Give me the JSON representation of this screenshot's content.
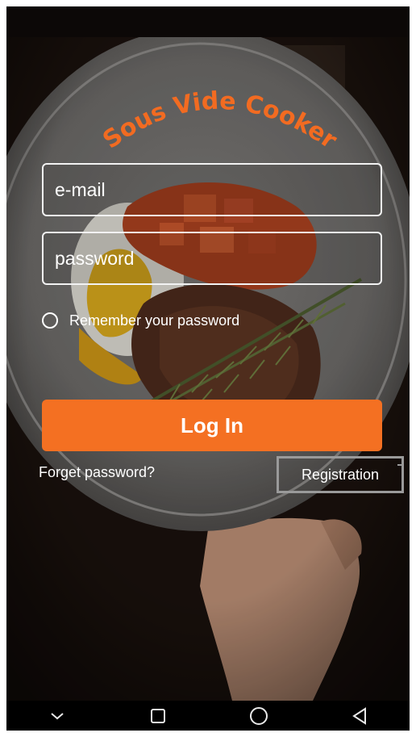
{
  "status_bar": {
    "left_text": "",
    "right_text": ""
  },
  "app": {
    "title": "Sous Vide Cooker"
  },
  "login_form": {
    "email_placeholder": "e-mail",
    "email_value": "",
    "password_placeholder": "password",
    "password_value": "",
    "remember_label": "Remember your password",
    "remember_checked": false,
    "login_label": "Log In",
    "forget_label": "Forget password?",
    "registration_label": "Registration"
  },
  "colors": {
    "accent": "#f47022",
    "title": "#f26b21",
    "background": "#150e0b"
  },
  "nav_bar": {
    "icons": [
      "chevron-down-icon",
      "square-recents-icon",
      "circle-home-icon",
      "triangle-back-icon"
    ]
  }
}
